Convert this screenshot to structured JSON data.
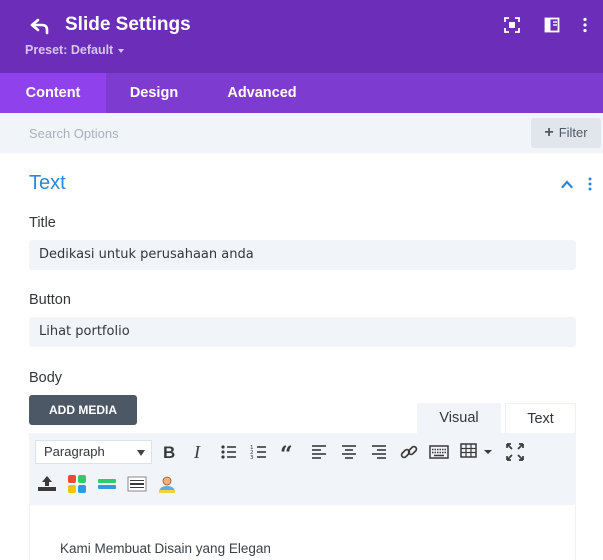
{
  "header": {
    "title": "Slide Settings",
    "preset": "Preset: Default",
    "background": "#6c2eb9"
  },
  "tabs": [
    {
      "label": "Content",
      "active": true
    },
    {
      "label": "Design",
      "active": false
    },
    {
      "label": "Advanced",
      "active": false
    }
  ],
  "search": {
    "placeholder": "Search Options",
    "filter_label": "Filter"
  },
  "section": {
    "title": "Text",
    "accent": "#2b87da"
  },
  "fields": {
    "title_label": "Title",
    "title_value": "Dedikasi untuk perusahaan anda",
    "button_label": "Button",
    "button_value": "Lihat portfolio",
    "body_label": "Body"
  },
  "editor": {
    "add_media": "ADD MEDIA",
    "visual_tab": "Visual",
    "text_tab": "Text",
    "format_select": "Paragraph",
    "content": "Kami Membuat Disain yang Elegan"
  }
}
